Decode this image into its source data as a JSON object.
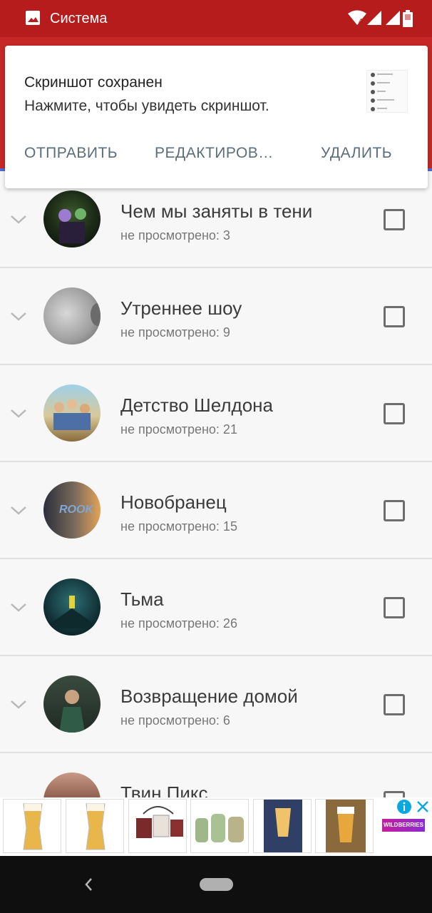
{
  "status_bar": {
    "title": "Система",
    "network_badge": "4"
  },
  "notification": {
    "title": "Скриншот сохранен",
    "text": "Нажмите, чтобы увидеть скриншот.",
    "actions": [
      "ОТПРАВИТЬ",
      "РЕДАКТИРОВ…",
      "УДАЛИТЬ"
    ]
  },
  "shows": [
    {
      "name": "Чем мы заняты в тени",
      "unwatched": "не просмотрено: 3"
    },
    {
      "name": "Утреннее шоу",
      "unwatched": "не просмотрено: 9"
    },
    {
      "name": "Детство Шелдона",
      "unwatched": "не просмотрено: 21"
    },
    {
      "name": "Новобранец",
      "unwatched": "не просмотрено: 15"
    },
    {
      "name": "Тьма",
      "unwatched": "не просмотрено: 26"
    },
    {
      "name": "Возвращение домой",
      "unwatched": "не просмотрено: 6"
    },
    {
      "name": "Твин Пикс",
      "unwatched": ""
    }
  ],
  "ad": {
    "brand": "WILDBERRIES"
  },
  "colors": {
    "status_bar": "#b71c1c",
    "app_bar": "#c62828",
    "accent": "#4f6ad1"
  }
}
